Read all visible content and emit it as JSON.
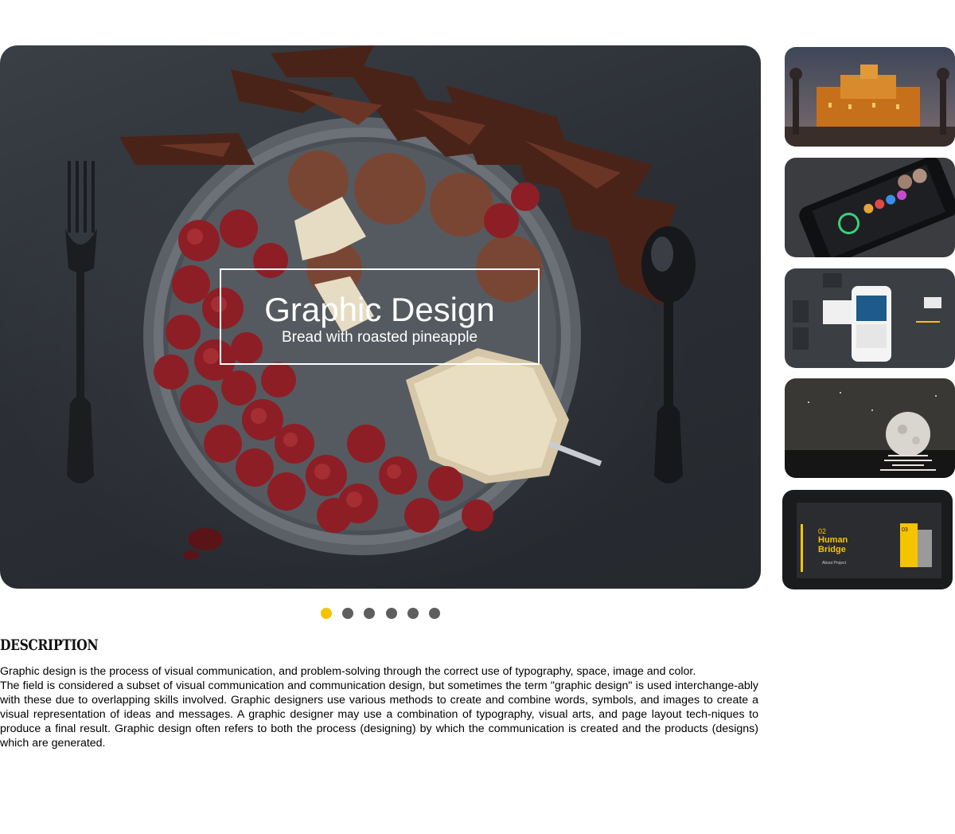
{
  "slider": {
    "active_index": 0,
    "caption": {
      "title": "Graphic Design",
      "subtitle": "Bread with roasted pineapple"
    },
    "main_image": "plate-of-strawberries-and-chocolate-photo",
    "dot_count": 6,
    "active_dot_color": "#f5c400",
    "inactive_dot_color": "#5e5e5e"
  },
  "thumbnails": [
    {
      "image": "castle-at-dusk-photo"
    },
    {
      "image": "phone-app-ui-photo"
    },
    {
      "image": "mobile-app-screens-photo"
    },
    {
      "image": "moon-over-water-photo"
    },
    {
      "image": "human-bridge-website-photo",
      "text": [
        "Human",
        "Bridge",
        "02",
        "03",
        "About Project"
      ]
    }
  ],
  "description": {
    "heading": "DESCRIPTION",
    "paragraphs": [
      "Graphic design is the process of visual communication, and problem-solving through the correct use of typography, space, image and color.",
      "The field is considered a subset of visual communication and communication design, but sometimes the term \"graphic design\" is used interchange-ably with these due to overlapping skills involved. Graphic designers use various methods to create and combine words, symbols, and images to create a visual representation of ideas and messages. A graphic designer may use a combination of typography, visual arts, and page layout tech-niques to produce a final result. Graphic design often refers to both the process (designing) by which the communication is created and the products (designs) which are generated."
    ]
  }
}
